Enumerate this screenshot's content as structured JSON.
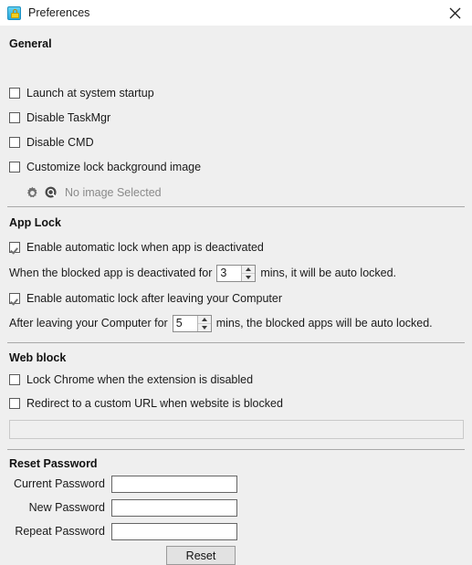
{
  "window": {
    "title": "Preferences",
    "icon": "app-lock-padlock-icon",
    "close_label": "×"
  },
  "sections": {
    "general": {
      "title": "General",
      "checkboxes": [
        {
          "label": "Launch at system startup",
          "checked": false
        },
        {
          "label": "Disable TaskMgr",
          "checked": false
        },
        {
          "label": "Disable CMD",
          "checked": false
        },
        {
          "label": "Customize lock background image",
          "checked": false
        }
      ],
      "image_picker": {
        "gear_icon": "gear-icon",
        "browse_icon": "search-icon",
        "status_text": "No image Selected"
      }
    },
    "app_lock": {
      "title": "App Lock",
      "deactivate": {
        "checkbox_label": "Enable automatic lock when app is deactivated",
        "checked": true,
        "sentence_before": "When the blocked app is deactivated for",
        "minutes": "3",
        "sentence_after": "mins, it will be auto locked."
      },
      "leaving": {
        "checkbox_label": "Enable automatic lock after leaving your Computer",
        "checked": true,
        "sentence_before": "After leaving your Computer for",
        "minutes": "5",
        "sentence_after": "mins, the blocked apps will be auto locked."
      }
    },
    "web_block": {
      "title": "Web block",
      "checkboxes": [
        {
          "label": "Lock Chrome when the extension is disabled",
          "checked": false
        },
        {
          "label": "Redirect to a custom URL when website is blocked",
          "checked": false
        }
      ],
      "url_value": "",
      "url_placeholder": ""
    },
    "reset_password": {
      "title": "Reset Password",
      "fields": [
        {
          "label": "Current Password",
          "value": ""
        },
        {
          "label": "New Password",
          "value": ""
        },
        {
          "label": "Repeat Password",
          "value": ""
        }
      ],
      "button_label": "Reset"
    }
  },
  "colors": {
    "body_bg": "#efefef",
    "titlebar_bg": "#ffffff",
    "accent": "#2ba8dd",
    "divider": "#a8a8a8",
    "muted_text": "#8a8a8a"
  }
}
